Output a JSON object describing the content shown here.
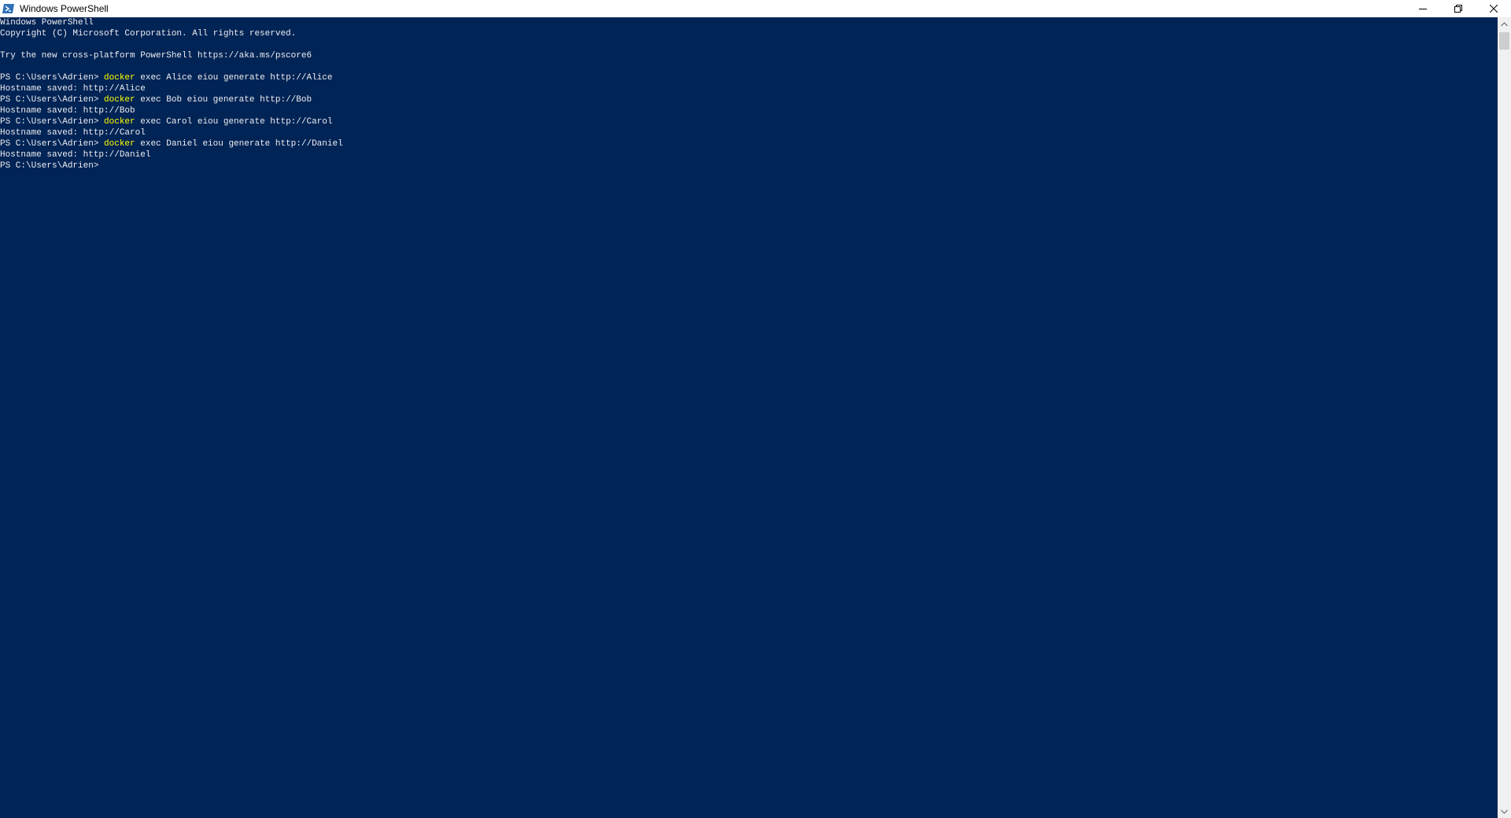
{
  "window": {
    "title": "Windows PowerShell",
    "icon": "powershell-icon",
    "controls": [
      "minimize-icon",
      "restore-icon",
      "close-icon"
    ]
  },
  "colors": {
    "console_background": "#012456",
    "console_text": "#eeedf0",
    "command_keyword": "#ffff00"
  },
  "console": {
    "lines": [
      {
        "text": "Windows PowerShell"
      },
      {
        "text": "Copyright (C) Microsoft Corporation. All rights reserved."
      },
      {
        "text": ""
      },
      {
        "text": "Try the new cross-platform PowerShell https://aka.ms/pscore6"
      },
      {
        "text": ""
      },
      {
        "prompt": "PS C:\\Users\\Adrien> ",
        "keyword": "docker",
        "args": " exec Alice eiou generate http://Alice"
      },
      {
        "text": "Hostname saved: http://Alice"
      },
      {
        "prompt": "PS C:\\Users\\Adrien> ",
        "keyword": "docker",
        "args": " exec Bob eiou generate http://Bob"
      },
      {
        "text": "Hostname saved: http://Bob"
      },
      {
        "prompt": "PS C:\\Users\\Adrien> ",
        "keyword": "docker",
        "args": " exec Carol eiou generate http://Carol"
      },
      {
        "text": "Hostname saved: http://Carol"
      },
      {
        "prompt": "PS C:\\Users\\Adrien> ",
        "keyword": "docker",
        "args": " exec Daniel eiou generate http://Daniel"
      },
      {
        "text": "Hostname saved: http://Daniel"
      },
      {
        "prompt": "PS C:\\Users\\Adrien> ",
        "keyword": "",
        "args": ""
      }
    ]
  }
}
